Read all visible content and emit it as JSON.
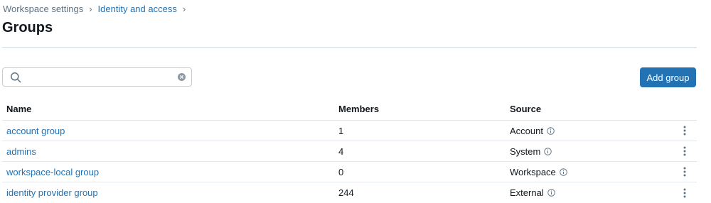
{
  "breadcrumb": {
    "items": [
      "Workspace settings",
      "Identity and access"
    ],
    "separator": "›"
  },
  "page": {
    "title": "Groups"
  },
  "search": {
    "placeholder": "",
    "value": ""
  },
  "actions": {
    "add_group_label": "Add group"
  },
  "table": {
    "columns": [
      "Name",
      "Members",
      "Source"
    ],
    "rows": [
      {
        "name": "account group",
        "members": "1",
        "source": "Account"
      },
      {
        "name": "admins",
        "members": "4",
        "source": "System"
      },
      {
        "name": "workspace-local group",
        "members": "0",
        "source": "Workspace"
      },
      {
        "name": "identity provider group",
        "members": "244",
        "source": "External"
      }
    ]
  },
  "colors": {
    "accent": "#2272b4",
    "divider": "#d1d9e1"
  },
  "icons": [
    "search-icon",
    "clear-icon",
    "info-icon",
    "kebab-menu-icon"
  ]
}
